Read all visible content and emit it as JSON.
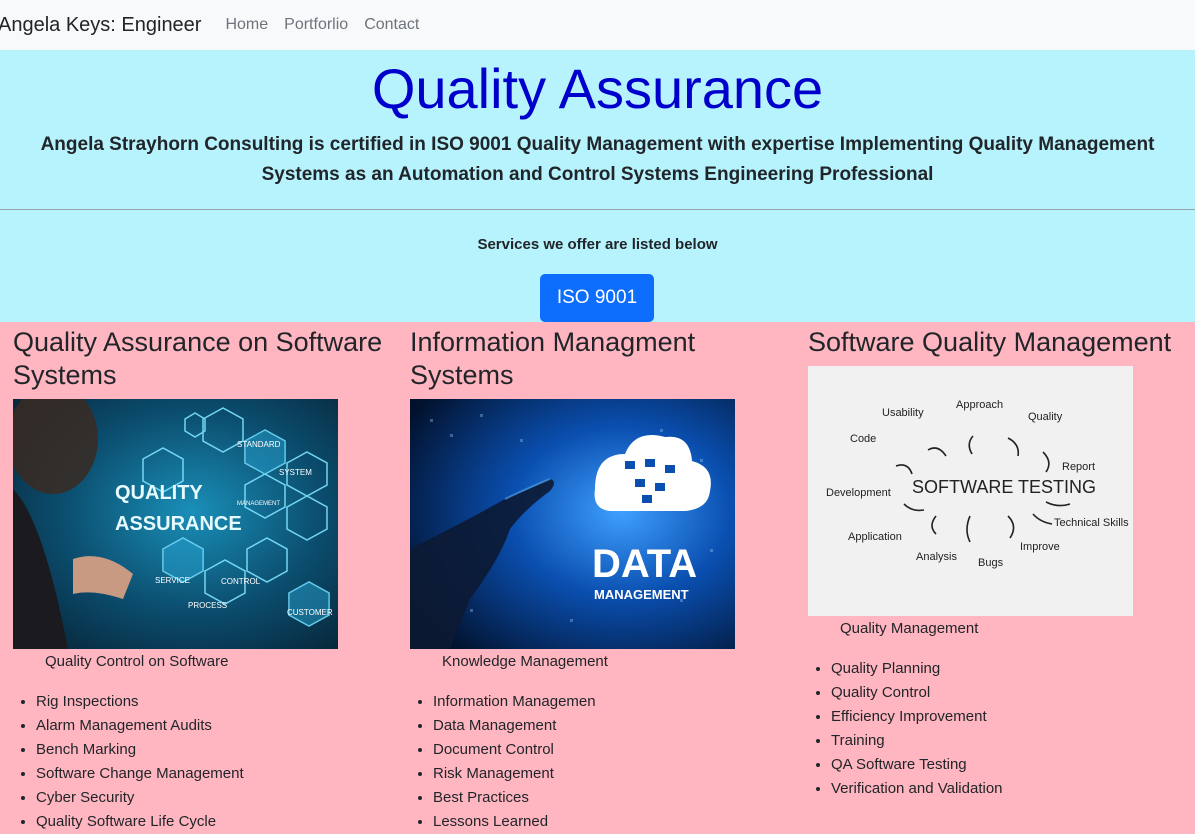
{
  "nav": {
    "brand": "Angela Keys: Engineer",
    "links": [
      "Home",
      "Portforlio",
      "Contact"
    ]
  },
  "hero": {
    "title": "Quality Assurance",
    "subtitle": "Angela Strayhorn Consulting is certified in ISO 9001 Quality Management with expertise Implementing Quality Management Systems as an Automation and Control Systems Engineering Professional",
    "services_text": "Services we offer are listed below",
    "button_label": "ISO 9001"
  },
  "columns": [
    {
      "title": "Quality Assurance on Software Systems",
      "image_text": [
        "QUALITY",
        "ASSURANCE"
      ],
      "image_hex_labels": [
        "STANDARD",
        "SYSTEM",
        "MANAGEMENT",
        "SERVICE",
        "PROCESS",
        "CONTROL",
        "CUSTOMER"
      ],
      "caption": "Quality Control on Software",
      "items": [
        "Rig Inspections",
        "Alarm Management Audits",
        "Bench Marking",
        "Software Change Management",
        "Cyber Security",
        "Quality Software Life Cycle"
      ]
    },
    {
      "title": "Information Managment Systems",
      "image_text": [
        "DATA",
        "MANAGEMENT"
      ],
      "caption": "Knowledge Management",
      "items": [
        "Information Managemen",
        "Data Management",
        "Document Control",
        "Risk Management",
        "Best Practices",
        "Lessons Learned"
      ]
    },
    {
      "title": "Software Quality Management",
      "image_center": "SOFTWARE TESTING",
      "image_words": [
        "Usability",
        "Approach",
        "Quality",
        "Code",
        "Report",
        "Development",
        "Technical Skills",
        "Application",
        "Analysis",
        "Bugs",
        "Improve"
      ],
      "caption": "Quality Management",
      "items": [
        "Quality Planning",
        "Quality Control",
        "Efficiency Improvement",
        "Training",
        "QA Software Testing",
        "Verification and Validation"
      ]
    }
  ],
  "colors": {
    "hero_bg": "#b6f3fd",
    "cards_bg": "#ffb6c1",
    "title_color": "#0000cc",
    "button_color": "#0d6efd"
  }
}
